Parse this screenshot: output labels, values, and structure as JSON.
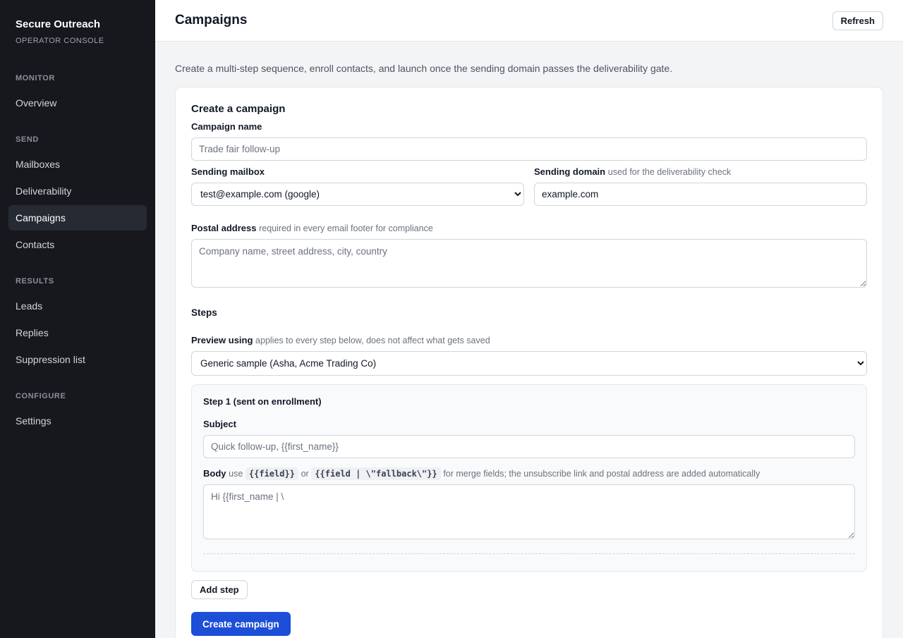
{
  "sidebar": {
    "brand_title": "Secure Outreach",
    "brand_subtitle": "OPERATOR CONSOLE",
    "sections": {
      "monitor": "MONITOR",
      "send": "SEND",
      "results": "RESULTS",
      "configure": "CONFIGURE"
    },
    "items": {
      "overview": "Overview",
      "mailboxes": "Mailboxes",
      "deliverability": "Deliverability",
      "campaigns": "Campaigns",
      "contacts": "Contacts",
      "leads": "Leads",
      "replies": "Replies",
      "suppression": "Suppression list",
      "settings": "Settings"
    },
    "active_item": "Campaigns"
  },
  "header": {
    "title": "Campaigns",
    "refresh_label": "Refresh"
  },
  "intro": "Create a multi-step sequence, enroll contacts, and launch once the sending domain passes the deliverability gate.",
  "form": {
    "title": "Create a campaign",
    "campaign_name": {
      "label": "Campaign name",
      "placeholder": "Trade fair follow-up",
      "value": ""
    },
    "sending_mailbox": {
      "label": "Sending mailbox",
      "selected": "test@example.com (google)"
    },
    "sending_domain": {
      "label": "Sending domain",
      "hint": "used for the deliverability check",
      "value": "example.com"
    },
    "postal_address": {
      "label": "Postal address",
      "hint": "required in every email footer for compliance",
      "placeholder": "Company name, street address, city, country"
    },
    "steps_title": "Steps",
    "preview": {
      "label": "Preview using",
      "hint": "applies to every step below, does not affect what gets saved",
      "selected": "Generic sample (Asha, Acme Trading Co)"
    },
    "step1": {
      "title": "Step 1 (sent on enrollment)",
      "subject_label": "Subject",
      "subject_placeholder": "Quick follow-up, {{first_name}}",
      "body_label": "Body",
      "body_hint_use": "use",
      "body_token1": "{{field}}",
      "body_hint_or": "or",
      "body_token2": "{{field | \\\"fallback\\\"}}",
      "body_hint_rest": "for merge fields; the unsubscribe link and postal address are added automatically",
      "body_placeholder": "Hi {{first_name | \\"
    },
    "add_step_label": "Add step",
    "create_label": "Create campaign"
  }
}
